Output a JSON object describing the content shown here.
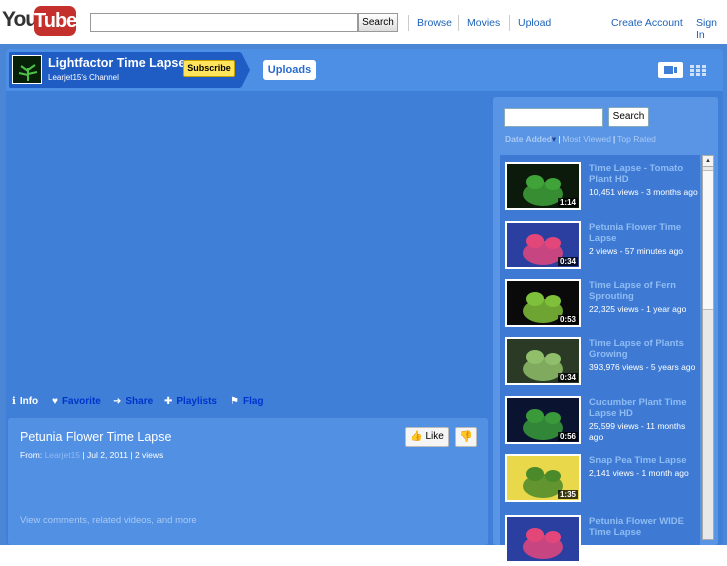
{
  "header": {
    "logo_you": "You",
    "logo_tube": "Tube",
    "search_button": "Search",
    "nav": [
      "Browse",
      "Movies",
      "Upload"
    ],
    "create_account": "Create Account",
    "sign_in": "Sign In"
  },
  "channel": {
    "name": "Lightfactor Time Lapse",
    "subtitle": "Learjet15's Channel",
    "subscribe_label": "Subscribe",
    "uploads_label": "Uploads"
  },
  "actions": {
    "info": "Info",
    "favorite": "Favorite",
    "share": "Share",
    "playlists": "Playlists",
    "flag": "Flag"
  },
  "video": {
    "title": "Petunia Flower Time Lapse",
    "from_label": "From:",
    "channel": "Learjet15",
    "date": "Jul 2, 2011",
    "views": "2 views",
    "like_label": "Like",
    "more_link": "View comments, related videos, and more"
  },
  "sidebar": {
    "search_button": "Search",
    "sort_active": "Date Added",
    "sort_options": [
      "Most Viewed",
      "Top Rated"
    ],
    "videos": [
      {
        "title": "Time Lapse - Tomato Plant HD",
        "meta": "10,451 views - 3 months ago",
        "duration": "1:14",
        "bg": "#0b1a0b",
        "fg": "#3fa33a"
      },
      {
        "title": "Petunia Flower Time Lapse",
        "meta": "2 views - 57 minutes ago",
        "duration": "0:34",
        "bg": "#2b3fa0",
        "fg": "#e3477a"
      },
      {
        "title": "Time Lapse of Fern Sprouting",
        "meta": "22,325 views - 1 year ago",
        "duration": "0:53",
        "bg": "#0a0a0a",
        "fg": "#7fc03a"
      },
      {
        "title": "Time Lapse of Plants Growing",
        "meta": "393,976 views - 5 years ago",
        "duration": "0:34",
        "bg": "#2a3a24",
        "fg": "#8fbf6a"
      },
      {
        "title": "Cucumber Plant Time Lapse HD",
        "meta": "25,599 views - 11 months ago",
        "duration": "0:56",
        "bg": "#0a1430",
        "fg": "#3a9a3a"
      },
      {
        "title": "Snap Pea Time Lapse",
        "meta": "2,141 views - 1 month ago",
        "duration": "1:35",
        "bg": "#e8d84a",
        "fg": "#4a8a2a"
      },
      {
        "title": "Petunia Flower WIDE Time Lapse",
        "meta": "",
        "duration": "",
        "bg": "#2b3fa0",
        "fg": "#e3477a"
      }
    ]
  }
}
